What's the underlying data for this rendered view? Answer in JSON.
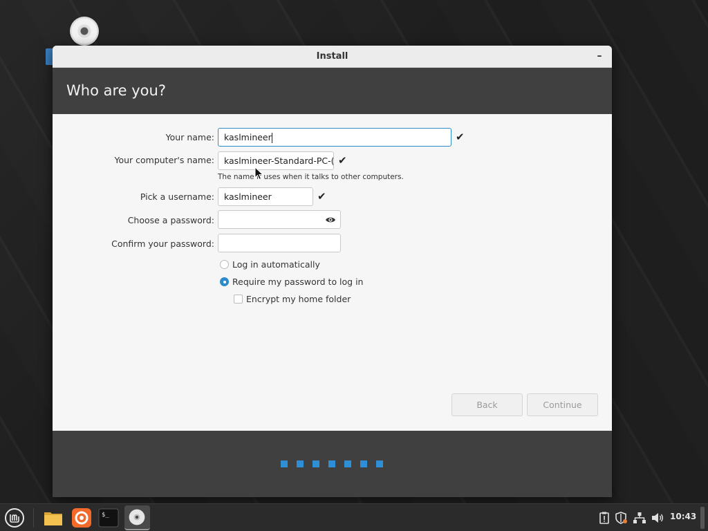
{
  "window": {
    "title": "Install",
    "minimize_glyph": "–"
  },
  "page": {
    "heading": "Who are you?"
  },
  "form": {
    "name_label": "Your name:",
    "name_value": "kaslmineer",
    "computer_label": "Your computer's name:",
    "computer_value": "kaslmineer-Standard-PC-(",
    "computer_hint": "The name it uses when it talks to other computers.",
    "username_label": "Pick a username:",
    "username_value": "kaslmineer",
    "password_label": "Choose a password:",
    "password_value": "",
    "confirm_label": "Confirm your password:",
    "confirm_value": "",
    "check_glyph": "✔"
  },
  "options": {
    "login_auto": {
      "label": "Log in automatically",
      "selected": false
    },
    "require_password": {
      "label": "Require my password to log in",
      "selected": true
    },
    "encrypt_home": {
      "label": "Encrypt my home folder",
      "checked": false
    }
  },
  "buttons": {
    "back": "Back",
    "continue": "Continue"
  },
  "progress": {
    "total_steps": 7,
    "accent": "#2f8fd6"
  },
  "taskbar": {
    "items": [
      "mint-menu-icon",
      "files-icon",
      "firefox-icon",
      "terminal-icon",
      "install-disc-icon"
    ],
    "clock": "10:43"
  },
  "colors": {
    "header_band": "#404040",
    "accent": "#2e8bc9"
  }
}
